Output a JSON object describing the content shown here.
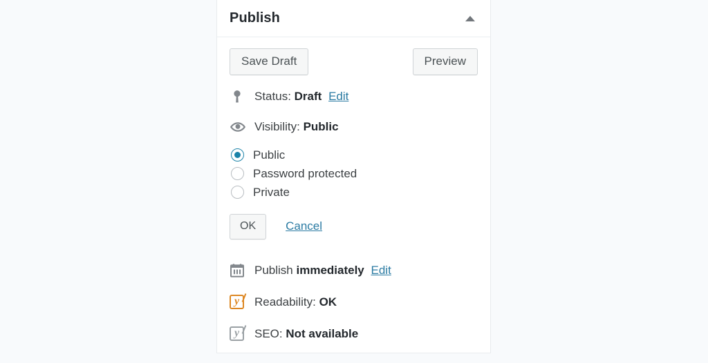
{
  "page": {
    "background_color": "#f8fafc"
  },
  "publish_box": {
    "title": "Publish",
    "toggle_icon": "caret-up-icon",
    "accent_color": "#1b82a8",
    "link_color": "#2b7ba3",
    "buttons": {
      "save_draft": "Save Draft",
      "preview": "Preview"
    },
    "status_row": {
      "icon": "pin-icon",
      "label": "Status:",
      "value": "Draft",
      "edit_link": "Edit"
    },
    "visibility_row": {
      "icon": "eye-icon",
      "label": "Visibility:",
      "value": "Public"
    },
    "visibility_options": [
      {
        "label": "Public",
        "selected": true
      },
      {
        "label": "Password protected",
        "selected": false
      },
      {
        "label": "Private",
        "selected": false
      }
    ],
    "visibility_actions": {
      "ok": "OK",
      "cancel": "Cancel"
    },
    "schedule_row": {
      "icon": "calendar-icon",
      "label": "Publish",
      "value": "immediately",
      "edit_link": "Edit"
    },
    "readability_row": {
      "icon": "yoast-icon-orange",
      "icon_color": "#dd8722",
      "label": "Readability:",
      "value": "OK"
    },
    "seo_row": {
      "icon": "yoast-icon-grey",
      "icon_color": "#9aa0a4",
      "label": "SEO:",
      "value": "Not available"
    }
  }
}
